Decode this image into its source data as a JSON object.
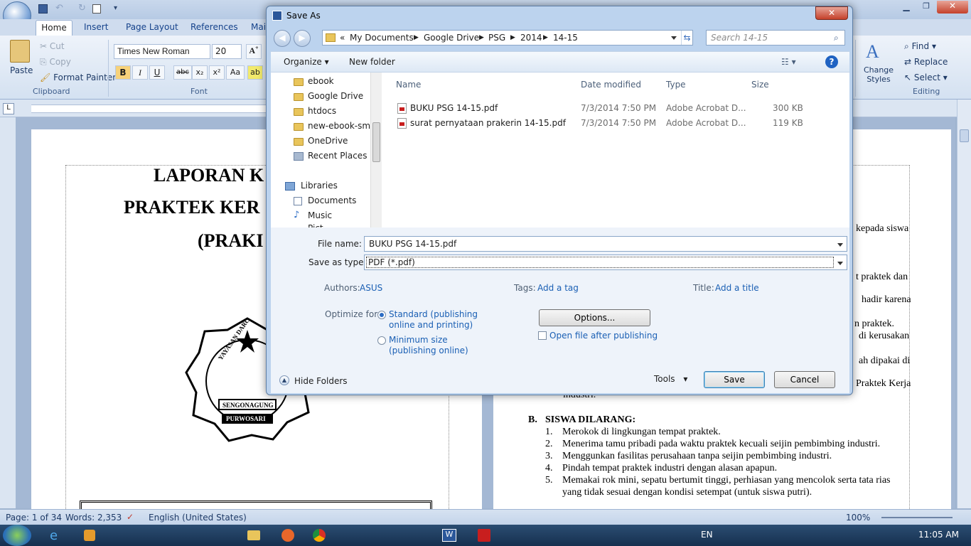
{
  "word": {
    "tabs": [
      "Home",
      "Insert",
      "Page Layout",
      "References",
      "Mai"
    ],
    "clipboard": {
      "paste": "Paste",
      "cut": "Cut",
      "copy": "Copy",
      "format_painter": "Format Painter",
      "group": "Clipboard"
    },
    "font": {
      "name": "Times New Roman",
      "size": "20",
      "group": "Font"
    },
    "editing": {
      "find": "Find",
      "replace": "Replace",
      "select": "Select",
      "group": "Editing",
      "change_styles": "Change Styles"
    },
    "page1_lines": [
      "LAPORAN K",
      "PRAKTEK KER",
      "(PRAKI"
    ],
    "seal_text": {
      "top": "YAYASAN DARC",
      "band1": "SENGONAGUNG",
      "band2": "PURWOSARI"
    },
    "page2_lines": [
      "kepada siswa",
      "t praktek dan",
      "hadir karena",
      "n praktek.",
      "di kerusakan",
      "ah dipakai di",
      "Praktek Kerja",
      "industri."
    ],
    "section_b": {
      "letter": "B.",
      "heading": "SISWA DILARANG:",
      "items": [
        {
          "num": "1.",
          "text": "Merokok di lingkungan tempat praktek."
        },
        {
          "num": "2.",
          "text": "Menerima tamu pribadi pada waktu praktek kecuali seijin pembimbing industri."
        },
        {
          "num": "3.",
          "text": "Menggunkan fasilitas perusahaan tanpa seijin pembimbing industri."
        },
        {
          "num": "4.",
          "text": "Pindah tempat praktek industri dengan alasan apapun."
        },
        {
          "num": "5.",
          "text": "Memakai rok mini, sepatu bertumit tinggi, perhiasan yang mencolok serta tata rias"
        },
        {
          "num": "",
          "text": "yang tidak sesuai dengan kondisi setempat (untuk siswa putri)."
        }
      ]
    },
    "status": {
      "page": "Page: 1 of 34",
      "words": "Words: 2,353",
      "language": "English (United States)",
      "zoom": "100%"
    }
  },
  "dialog": {
    "title": "Save As",
    "breadcrumb": [
      "My Documents",
      "Google Drive",
      "PSG",
      "2014",
      "14-15"
    ],
    "search_placeholder": "Search 14-15",
    "organize": "Organize",
    "new_folder": "New folder",
    "nav_items": [
      "ebook",
      "Google Drive",
      "htdocs",
      "new-ebook-smk",
      "OneDrive",
      "Recent Places"
    ],
    "libraries": "Libraries",
    "library_items": [
      "Documents",
      "Music",
      "Pict"
    ],
    "columns": {
      "name": "Name",
      "date": "Date modified",
      "type": "Type",
      "size": "Size"
    },
    "files": [
      {
        "name": "BUKU PSG 14-15.pdf",
        "date": "7/3/2014 7:50 PM",
        "type": "Adobe Acrobat D...",
        "size": "300 KB"
      },
      {
        "name": "surat pernyataan prakerin 14-15.pdf",
        "date": "7/3/2014 7:50 PM",
        "type": "Adobe Acrobat D...",
        "size": "119 KB"
      }
    ],
    "file_name_label": "File name:",
    "file_name_value": "BUKU PSG 14-15.pdf",
    "save_type_label": "Save as type:",
    "save_type_value": "PDF (*.pdf)",
    "authors_label": "Authors:",
    "authors_value": "ASUS",
    "tags_label": "Tags:",
    "tags_value": "Add a tag",
    "title_label": "Title:",
    "title_value": "Add a title",
    "optimize_label": "Optimize for:",
    "opt_standard_1": "Standard (publishing",
    "opt_standard_2": "online and printing)",
    "opt_min_1": "Minimum size",
    "opt_min_2": "(publishing online)",
    "options_btn": "Options...",
    "open_after": "Open file after publishing",
    "hide_folders": "Hide Folders",
    "tools": "Tools",
    "save": "Save",
    "cancel": "Cancel"
  },
  "taskbar": {
    "lang": "EN",
    "time": "11:05 AM"
  }
}
